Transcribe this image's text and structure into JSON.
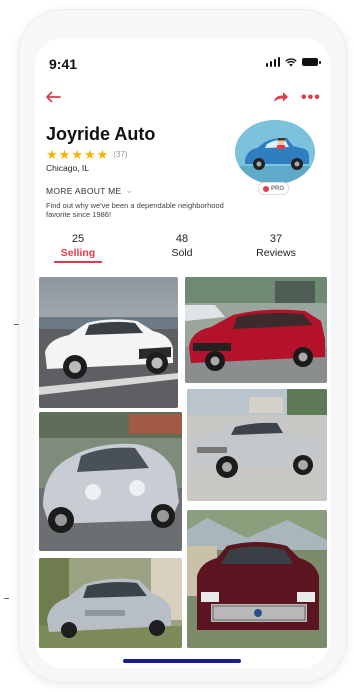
{
  "status_bar": {
    "time": "9:41"
  },
  "nav": {
    "back_icon": "arrow-left-icon",
    "share_icon": "share-arrow-icon",
    "more_icon": "more-dots-icon",
    "more_glyph": "•••"
  },
  "store": {
    "name": "Joyride Auto",
    "stars": 5,
    "rating_count": "(37)",
    "location": "Chicago, IL",
    "more_about": "MORE ABOUT ME",
    "bio": "Find out why we've been a dependable neighborhood favorite since 1986!",
    "badge": "PRO"
  },
  "stats": [
    {
      "count": "25",
      "label": "Selling",
      "active": true
    },
    {
      "count": "48",
      "label": "Sold",
      "active": false
    },
    {
      "count": "37",
      "label": "Reviews",
      "active": false
    }
  ],
  "listings": [
    {
      "name": "white-sedan",
      "color": "#f2f2f2"
    },
    {
      "name": "red-hatchback",
      "color": "#b3122a"
    },
    {
      "name": "silver-beetle",
      "color": "#c7ccd2"
    },
    {
      "name": "silver-pickup",
      "color": "#bfc3c6"
    },
    {
      "name": "silver-civic",
      "color": "#b8bec5"
    },
    {
      "name": "maroon-truck",
      "color": "#5b1420"
    }
  ],
  "colors": {
    "accent": "#e33a4c",
    "star": "#f5b400",
    "home_indicator": "#1c1c8a"
  }
}
